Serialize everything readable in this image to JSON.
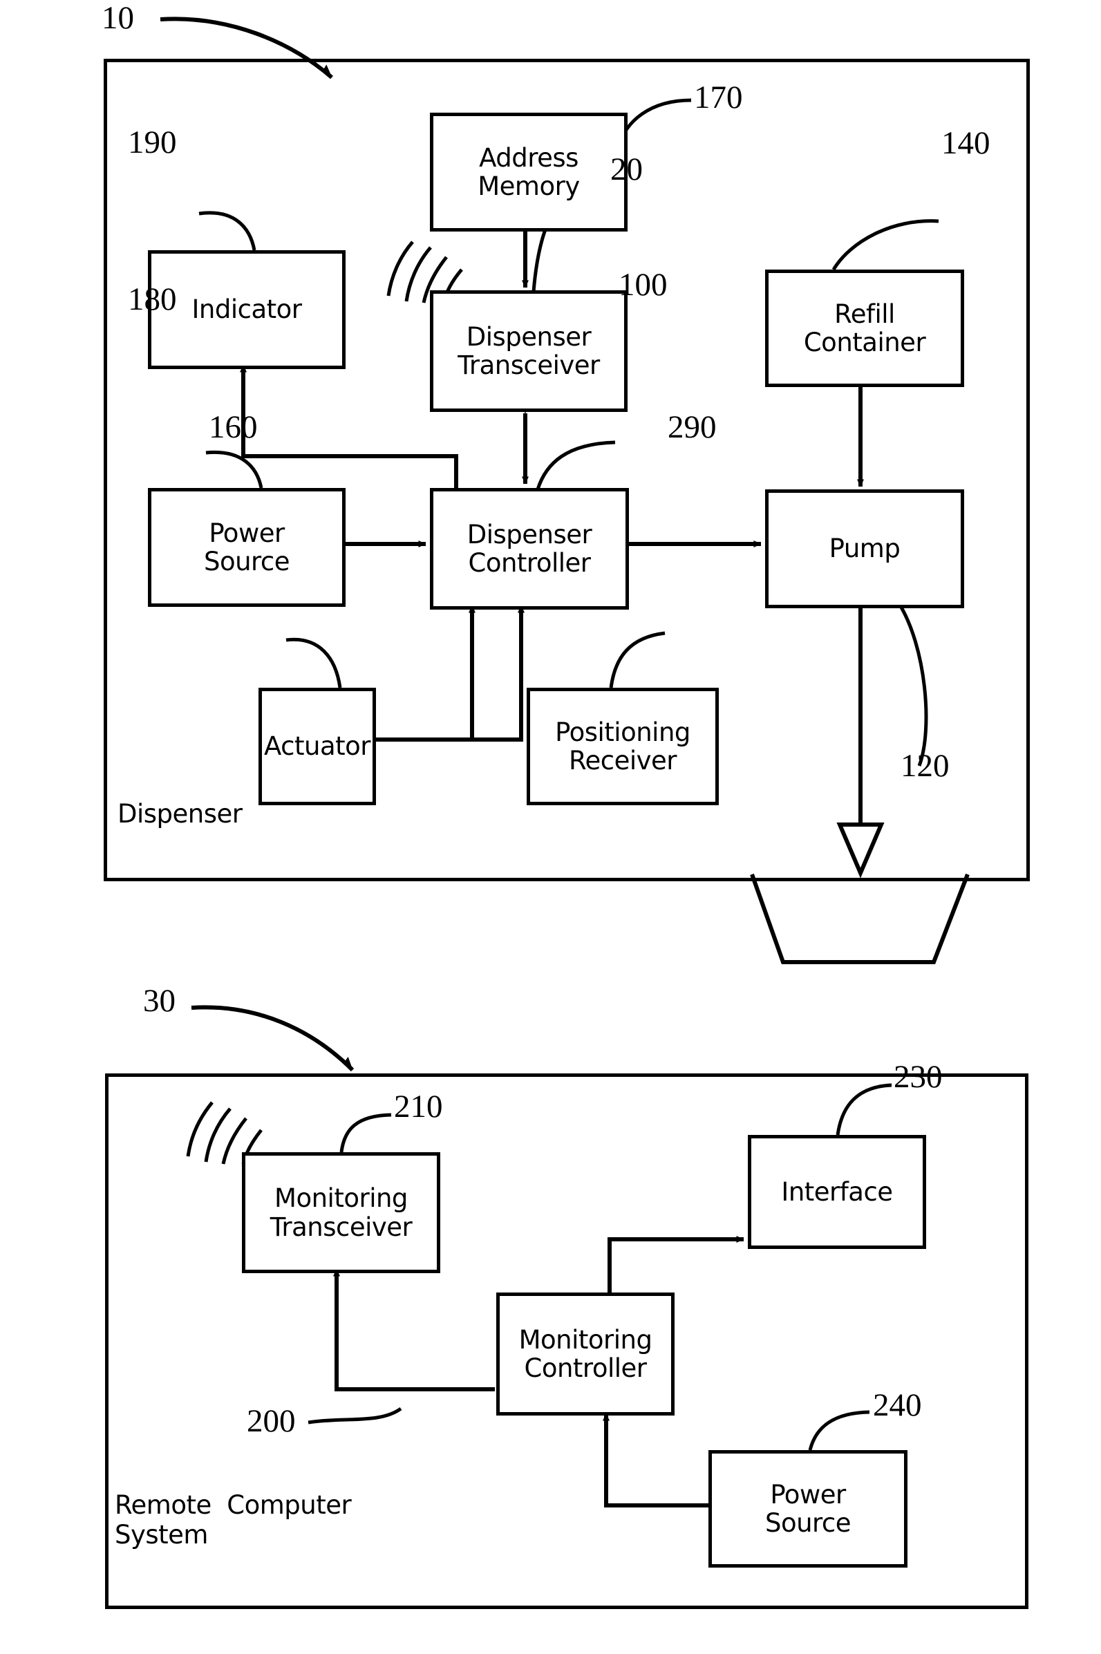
{
  "figure": {
    "title": "Dispenser and Remote Computer System block diagram",
    "stroke_color": "#000000",
    "background_color": "#ffffff"
  },
  "dispenser_unit": {
    "ref": "10",
    "caption": "Dispenser",
    "boxes": {
      "address_memory": {
        "label": "Address\nMemory",
        "ref": "170"
      },
      "indicator": {
        "label": "Indicator",
        "ref": "190"
      },
      "dispenser_transceiver": {
        "label": "Dispenser\nTransceiver",
        "ref": "20"
      },
      "refill_container": {
        "label": "Refill\nContainer",
        "ref": "140"
      },
      "power_source": {
        "label": "Power\nSource",
        "ref": "180"
      },
      "dispenser_controller": {
        "label": "Dispenser\nController",
        "ref": "100"
      },
      "pump": {
        "label": "Pump",
        "ref": ""
      },
      "actuator": {
        "label": "Actuator",
        "ref": "160"
      },
      "positioning_receiver": {
        "label": "Positioning\nReceiver",
        "ref": "290"
      }
    },
    "outlet_ref": "120"
  },
  "remote_unit": {
    "ref": "30",
    "caption": "Remote  Computer\nSystem",
    "boxes": {
      "monitoring_transceiver": {
        "label": "Monitoring\nTransceiver",
        "ref": "210"
      },
      "interface": {
        "label": "Interface",
        "ref": "230"
      },
      "monitoring_controller": {
        "label": "Monitoring\nController",
        "ref": "200"
      },
      "power_source": {
        "label": "Power\nSource",
        "ref": "240"
      }
    }
  },
  "icons": {
    "wireless_waves": "wireless-waves-icon",
    "nozzle": "nozzle-triangle-icon",
    "basin": "basin-trapezoid-icon"
  }
}
